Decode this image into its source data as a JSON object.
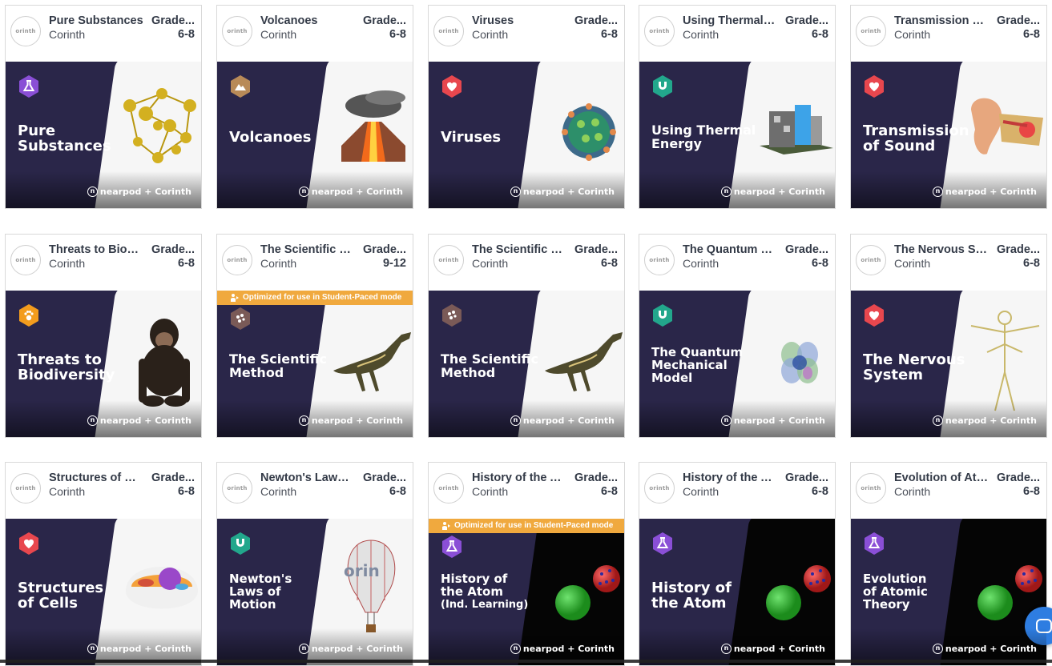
{
  "brand_text": "nearpod + Corinth",
  "logo_text": "orinth",
  "optimized_label": "Optimized for use in Student-Paced mode",
  "cards": [
    {
      "title": "Pure Substances",
      "author": "Corinth",
      "grade_label": "Grade...",
      "grade": "6-8",
      "thumb_title_lines": [
        "Pure",
        "Substances"
      ],
      "badge": "flask-icon",
      "badge_color": "#8a4fd6",
      "art": "molecule"
    },
    {
      "title": "Volcanoes",
      "author": "Corinth",
      "grade_label": "Grade...",
      "grade": "6-8",
      "thumb_title_lines": [
        "Volcanoes"
      ],
      "badge": "mountain-icon",
      "badge_color": "#b88a58",
      "art": "volcano"
    },
    {
      "title": "Viruses",
      "author": "Corinth",
      "grade_label": "Grade...",
      "grade": "6-8",
      "thumb_title_lines": [
        "Viruses"
      ],
      "badge": "heart-icon",
      "badge_color": "#e8474e",
      "art": "virus"
    },
    {
      "title": "Using Thermal E...",
      "author": "Corinth",
      "grade_label": "Grade...",
      "grade": "6-8",
      "thumb_title_lines": [
        "Using Thermal",
        "Energy"
      ],
      "badge": "magnet-icon",
      "badge_color": "#22a78c",
      "art": "building"
    },
    {
      "title": "Transmission of ...",
      "author": "Corinth",
      "grade_label": "Grade...",
      "grade": "6-8",
      "thumb_title_lines": [
        "Transmission",
        "of Sound"
      ],
      "badge": "heart-icon",
      "badge_color": "#e8474e",
      "art": "ear"
    },
    {
      "title": "Threats to Biodi...",
      "author": "Corinth",
      "grade_label": "Grade...",
      "grade": "6-8",
      "thumb_title_lines": [
        "Threats to",
        "Biodiversity"
      ],
      "badge": "paw-icon",
      "badge_color": "#f39c1d",
      "art": "chimp"
    },
    {
      "title": "The Scientific M...",
      "author": "Corinth",
      "grade_label": "Grade...",
      "grade": "9-12",
      "thumb_title_lines": [
        "The Scientific",
        "Method"
      ],
      "badge": "scatter-icon",
      "badge_color": "#7a5a57",
      "art": "dino",
      "optimized": true
    },
    {
      "title": "The Scientific M...",
      "author": "Corinth",
      "grade_label": "Grade...",
      "grade": "6-8",
      "thumb_title_lines": [
        "The Scientific",
        "Method"
      ],
      "badge": "scatter-icon",
      "badge_color": "#7a5a57",
      "art": "dino"
    },
    {
      "title": "The Quantum M...",
      "author": "Corinth",
      "grade_label": "Grade...",
      "grade": "6-8",
      "thumb_title_lines": [
        "The Quantum",
        "Mechanical",
        "Model"
      ],
      "badge": "magnet-icon",
      "badge_color": "#22a78c",
      "art": "orbital"
    },
    {
      "title": "The Nervous Sy...",
      "author": "Corinth",
      "grade_label": "Grade...",
      "grade": "6-8",
      "thumb_title_lines": [
        "The Nervous",
        "System"
      ],
      "badge": "heart-icon",
      "badge_color": "#e8474e",
      "art": "nervous"
    },
    {
      "title": "Structures of Ce...",
      "author": "Corinth",
      "grade_label": "Grade...",
      "grade": "6-8",
      "thumb_title_lines": [
        "Structures",
        "of Cells"
      ],
      "badge": "heart-icon",
      "badge_color": "#e8474e",
      "art": "cell"
    },
    {
      "title": "Newton's Laws ...",
      "author": "Corinth",
      "grade_label": "Grade...",
      "grade": "6-8",
      "thumb_title_lines": [
        "Newton's",
        "Laws of",
        "Motion"
      ],
      "badge": "magnet-icon",
      "badge_color": "#22a78c",
      "art": "balloon"
    },
    {
      "title": "History of the A...",
      "author": "Corinth",
      "grade_label": "Grade...",
      "grade": "6-8",
      "thumb_title_lines": [
        "History of",
        "the Atom",
        "(Ind. Learning)"
      ],
      "badge": "flask-icon",
      "badge_color": "#8a4fd6",
      "art": "atom",
      "optimized": true
    },
    {
      "title": "History of the A...",
      "author": "Corinth",
      "grade_label": "Grade...",
      "grade": "6-8",
      "thumb_title_lines": [
        "History of",
        "the Atom"
      ],
      "badge": "flask-icon",
      "badge_color": "#8a4fd6",
      "art": "atom"
    },
    {
      "title": "Evolution of Ato...",
      "author": "Corinth",
      "grade_label": "Grade...",
      "grade": "6-8",
      "thumb_title_lines": [
        "Evolution",
        "of Atomic",
        "Theory"
      ],
      "badge": "flask-icon",
      "badge_color": "#8a4fd6",
      "art": "atom"
    }
  ]
}
